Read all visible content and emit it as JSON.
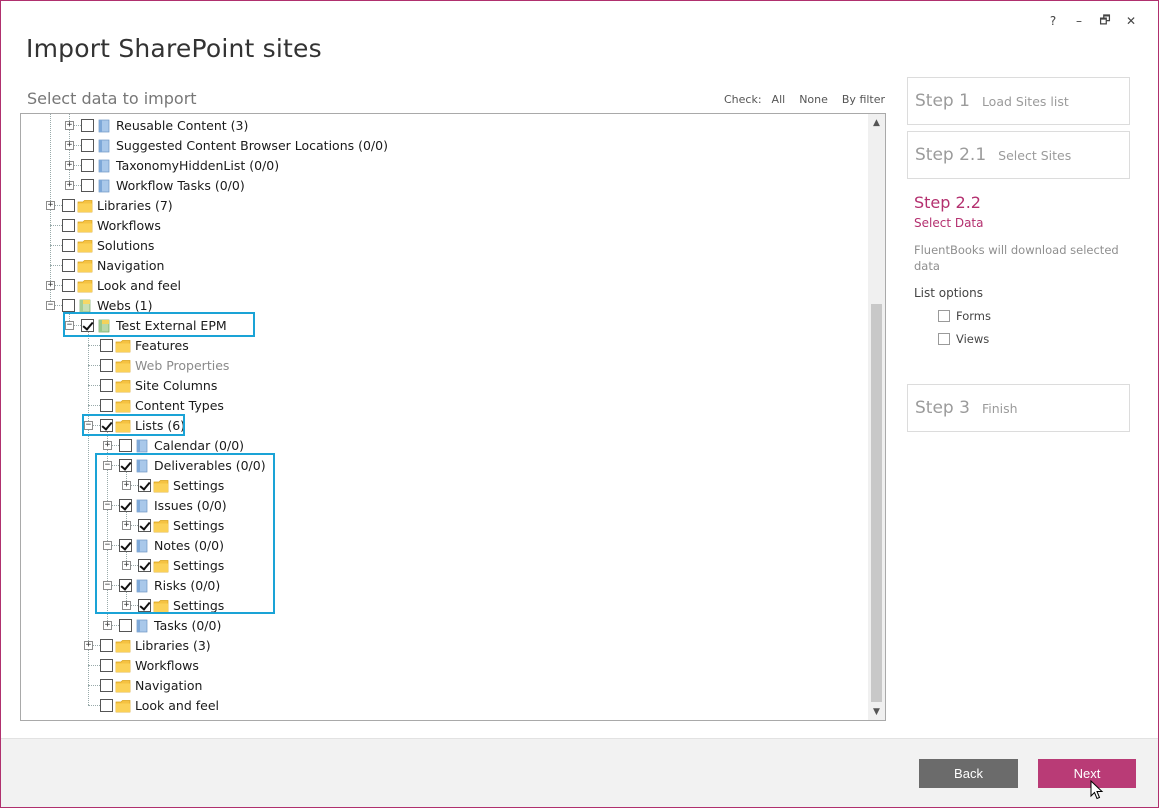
{
  "window": {
    "title": "Import SharePoint sites",
    "controls": {
      "help": "?",
      "minimize": "–",
      "restore": "🗗",
      "close": "✕"
    }
  },
  "section_title": "Select data to import",
  "check_controls": {
    "label": "Check:",
    "all": "All",
    "none": "None",
    "by_filter": "By filter"
  },
  "tree": [
    {
      "label": "Reusable Content (3)",
      "level": 2,
      "expander": "plus",
      "checked": false,
      "icon": "list-icon"
    },
    {
      "label": "Suggested Content Browser Locations (0/0)",
      "level": 2,
      "expander": "plus",
      "checked": false,
      "icon": "list-icon"
    },
    {
      "label": "TaxonomyHiddenList (0/0)",
      "level": 2,
      "expander": "plus",
      "checked": false,
      "icon": "list-icon"
    },
    {
      "label": "Workflow Tasks (0/0)",
      "level": 2,
      "expander": "plus",
      "checked": false,
      "icon": "list-icon"
    },
    {
      "label": "Libraries (7)",
      "level": 1,
      "expander": "plus",
      "checked": false,
      "icon": "folder-icon"
    },
    {
      "label": "Workflows",
      "level": 1,
      "expander": "none",
      "checked": false,
      "icon": "folder-icon"
    },
    {
      "label": "Solutions",
      "level": 1,
      "expander": "none",
      "checked": false,
      "icon": "folder-icon"
    },
    {
      "label": "Navigation",
      "level": 1,
      "expander": "none",
      "checked": false,
      "icon": "folder-icon"
    },
    {
      "label": "Look and feel",
      "level": 1,
      "expander": "plus",
      "checked": false,
      "icon": "folder-icon"
    },
    {
      "label": "Webs (1)",
      "level": 1,
      "expander": "minus",
      "checked": false,
      "icon": "web-icon"
    },
    {
      "label": "Test External EPM",
      "level": 2,
      "expander": "minus",
      "checked": true,
      "icon": "site-icon"
    },
    {
      "label": "Features",
      "level": 3,
      "expander": "none",
      "checked": false,
      "icon": "folder-icon"
    },
    {
      "label": "Web Properties",
      "level": 3,
      "expander": "none",
      "checked": false,
      "icon": "folder-icon",
      "dim": true
    },
    {
      "label": "Site Columns",
      "level": 3,
      "expander": "none",
      "checked": false,
      "icon": "folder-icon"
    },
    {
      "label": "Content Types",
      "level": 3,
      "expander": "none",
      "checked": false,
      "icon": "folder-icon"
    },
    {
      "label": "Lists (6)",
      "level": 3,
      "expander": "minus",
      "checked": true,
      "icon": "folder-icon"
    },
    {
      "label": "Calendar (0/0)",
      "level": 4,
      "expander": "plus",
      "checked": false,
      "icon": "list-icon"
    },
    {
      "label": "Deliverables (0/0)",
      "level": 4,
      "expander": "minus",
      "checked": true,
      "icon": "list-icon"
    },
    {
      "label": "Settings",
      "level": 5,
      "expander": "plus",
      "checked": true,
      "icon": "folder-icon"
    },
    {
      "label": "Issues (0/0)",
      "level": 4,
      "expander": "minus",
      "checked": true,
      "icon": "list-icon"
    },
    {
      "label": "Settings",
      "level": 5,
      "expander": "plus",
      "checked": true,
      "icon": "folder-icon"
    },
    {
      "label": "Notes (0/0)",
      "level": 4,
      "expander": "minus",
      "checked": true,
      "icon": "list-icon"
    },
    {
      "label": "Settings",
      "level": 5,
      "expander": "plus",
      "checked": true,
      "icon": "folder-icon"
    },
    {
      "label": "Risks (0/0)",
      "level": 4,
      "expander": "minus",
      "checked": true,
      "icon": "list-icon"
    },
    {
      "label": "Settings",
      "level": 5,
      "expander": "plus",
      "checked": true,
      "icon": "folder-icon"
    },
    {
      "label": "Tasks (0/0)",
      "level": 4,
      "expander": "plus",
      "checked": false,
      "icon": "list-icon"
    },
    {
      "label": "Libraries (3)",
      "level": 3,
      "expander": "plus",
      "checked": false,
      "icon": "folder-icon"
    },
    {
      "label": "Workflows",
      "level": 3,
      "expander": "none",
      "checked": false,
      "icon": "folder-icon"
    },
    {
      "label": "Navigation",
      "level": 3,
      "expander": "none",
      "checked": false,
      "icon": "folder-icon"
    },
    {
      "label": "Look and feel",
      "level": 3,
      "expander": "none",
      "checked": false,
      "icon": "folder-icon"
    }
  ],
  "steps": {
    "step1": {
      "num": "Step 1",
      "name": "Load Sites list"
    },
    "step21": {
      "num": "Step 2.1",
      "name": "Select Sites"
    },
    "step22": {
      "num": "Step 2.2",
      "name": "Select Data",
      "desc": "FluentBooks will download selected data",
      "options_title": "List options",
      "options": [
        {
          "label": "Forms",
          "checked": false
        },
        {
          "label": "Views",
          "checked": false
        }
      ]
    },
    "step3": {
      "num": "Step 3",
      "name": "Finish"
    }
  },
  "buttons": {
    "back": "Back",
    "next": "Next"
  },
  "colors": {
    "accent": "#b4306f",
    "highlight": "#1aa3d6",
    "back_button": "#6b6b6b",
    "next_button": "#b93b76",
    "folder": "#f5c242"
  }
}
